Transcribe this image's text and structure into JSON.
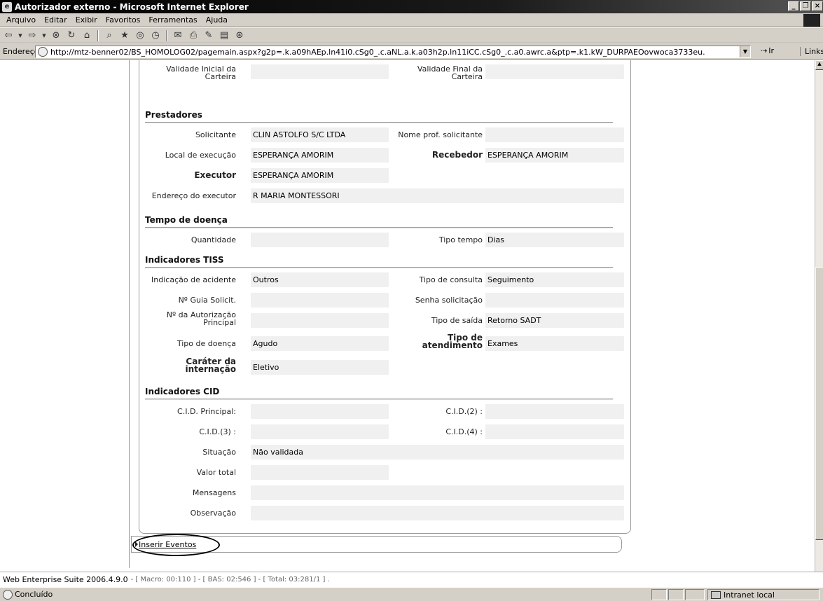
{
  "window": {
    "title": "Autorizador externo - Microsoft Internet Explorer"
  },
  "menu": [
    "Arquivo",
    "Editar",
    "Exibir",
    "Favoritos",
    "Ferramentas",
    "Ajuda"
  ],
  "address": {
    "label": "Endereço",
    "url": "http://mtz-benner02/BS_HOMOLOG02/pagemain.aspx?g2p=.k.a09hAEp.ln41i0.cSg0_.c.aNL.a.k.a03h2p.ln11iCC.cSg0_.c.a0.awrc.a&ptp=.k1.kW_DURPAEOovwoca3733eu.",
    "go": "Ir",
    "links": "Links"
  },
  "form": {
    "validade_inicial": {
      "label": "Validade Inicial da Carteira",
      "value": ""
    },
    "validade_final": {
      "label": "Validade Final da Carteira",
      "value": ""
    },
    "prestadores": {
      "title": "Prestadores",
      "solicitante": {
        "label": "Solicitante",
        "value": "CLIN ASTOLFO S/C LTDA"
      },
      "nome_prof": {
        "label": "Nome prof. solicitante",
        "value": ""
      },
      "local_execucao": {
        "label": "Local de execução",
        "value": "ESPERANÇA AMORIM"
      },
      "recebedor": {
        "label": "Recebedor",
        "value": "ESPERANÇA AMORIM"
      },
      "executor": {
        "label": "Executor",
        "value": "ESPERANÇA AMORIM"
      },
      "endereco_executor": {
        "label": "Endereço do executor",
        "value": "R MARIA MONTESSORI"
      }
    },
    "tempo_doenca": {
      "title": "Tempo de doença",
      "quantidade": {
        "label": "Quantidade",
        "value": ""
      },
      "tipo_tempo": {
        "label": "Tipo tempo",
        "value": "Dias"
      }
    },
    "indicadores_tiss": {
      "title": "Indicadores TISS",
      "indicacao_acidente": {
        "label": "Indicação de acidente",
        "value": "Outros"
      },
      "tipo_consulta": {
        "label": "Tipo de consulta",
        "value": "Seguimento"
      },
      "guia_solicit": {
        "label": "Nº Guia Solicit.",
        "value": ""
      },
      "senha_solicitacao": {
        "label": "Senha solicitação",
        "value": ""
      },
      "autorizacao_principal": {
        "label": "Nº da Autorização Principal",
        "value": ""
      },
      "tipo_saida": {
        "label": "Tipo de saída",
        "value": "Retorno SADT"
      },
      "tipo_doenca": {
        "label": "Tipo de doença",
        "value": "Agudo"
      },
      "tipo_atendimento": {
        "label": "Tipo de atendimento",
        "value": "Exames"
      },
      "carater_internacao": {
        "label": "Caráter da internação",
        "value": "Eletivo"
      }
    },
    "indicadores_cid": {
      "title": "Indicadores CID",
      "cid_principal": {
        "label": "C.I.D. Principal:",
        "value": ""
      },
      "cid2": {
        "label": "C.I.D.(2) :",
        "value": ""
      },
      "cid3": {
        "label": "C.I.D.(3) :",
        "value": ""
      },
      "cid4": {
        "label": "C.I.D.(4) :",
        "value": ""
      },
      "situacao": {
        "label": "Situação",
        "value": "Não validada"
      },
      "valor_total": {
        "label": "Valor total",
        "value": ""
      },
      "mensagens": {
        "label": "Mensagens",
        "value": ""
      },
      "observacao": {
        "label": "Observação",
        "value": ""
      }
    }
  },
  "insert_events": "Inserir Eventos",
  "footer": {
    "suite": "Web Enterprise Suite 2006.4.9.0",
    "meta": "- [ Macro: 00:110 ] - [ BAS: 02:546 ] - [ Total: 03:281/1 ] ."
  },
  "status": {
    "text": "Concluído",
    "zone": "Intranet local"
  }
}
